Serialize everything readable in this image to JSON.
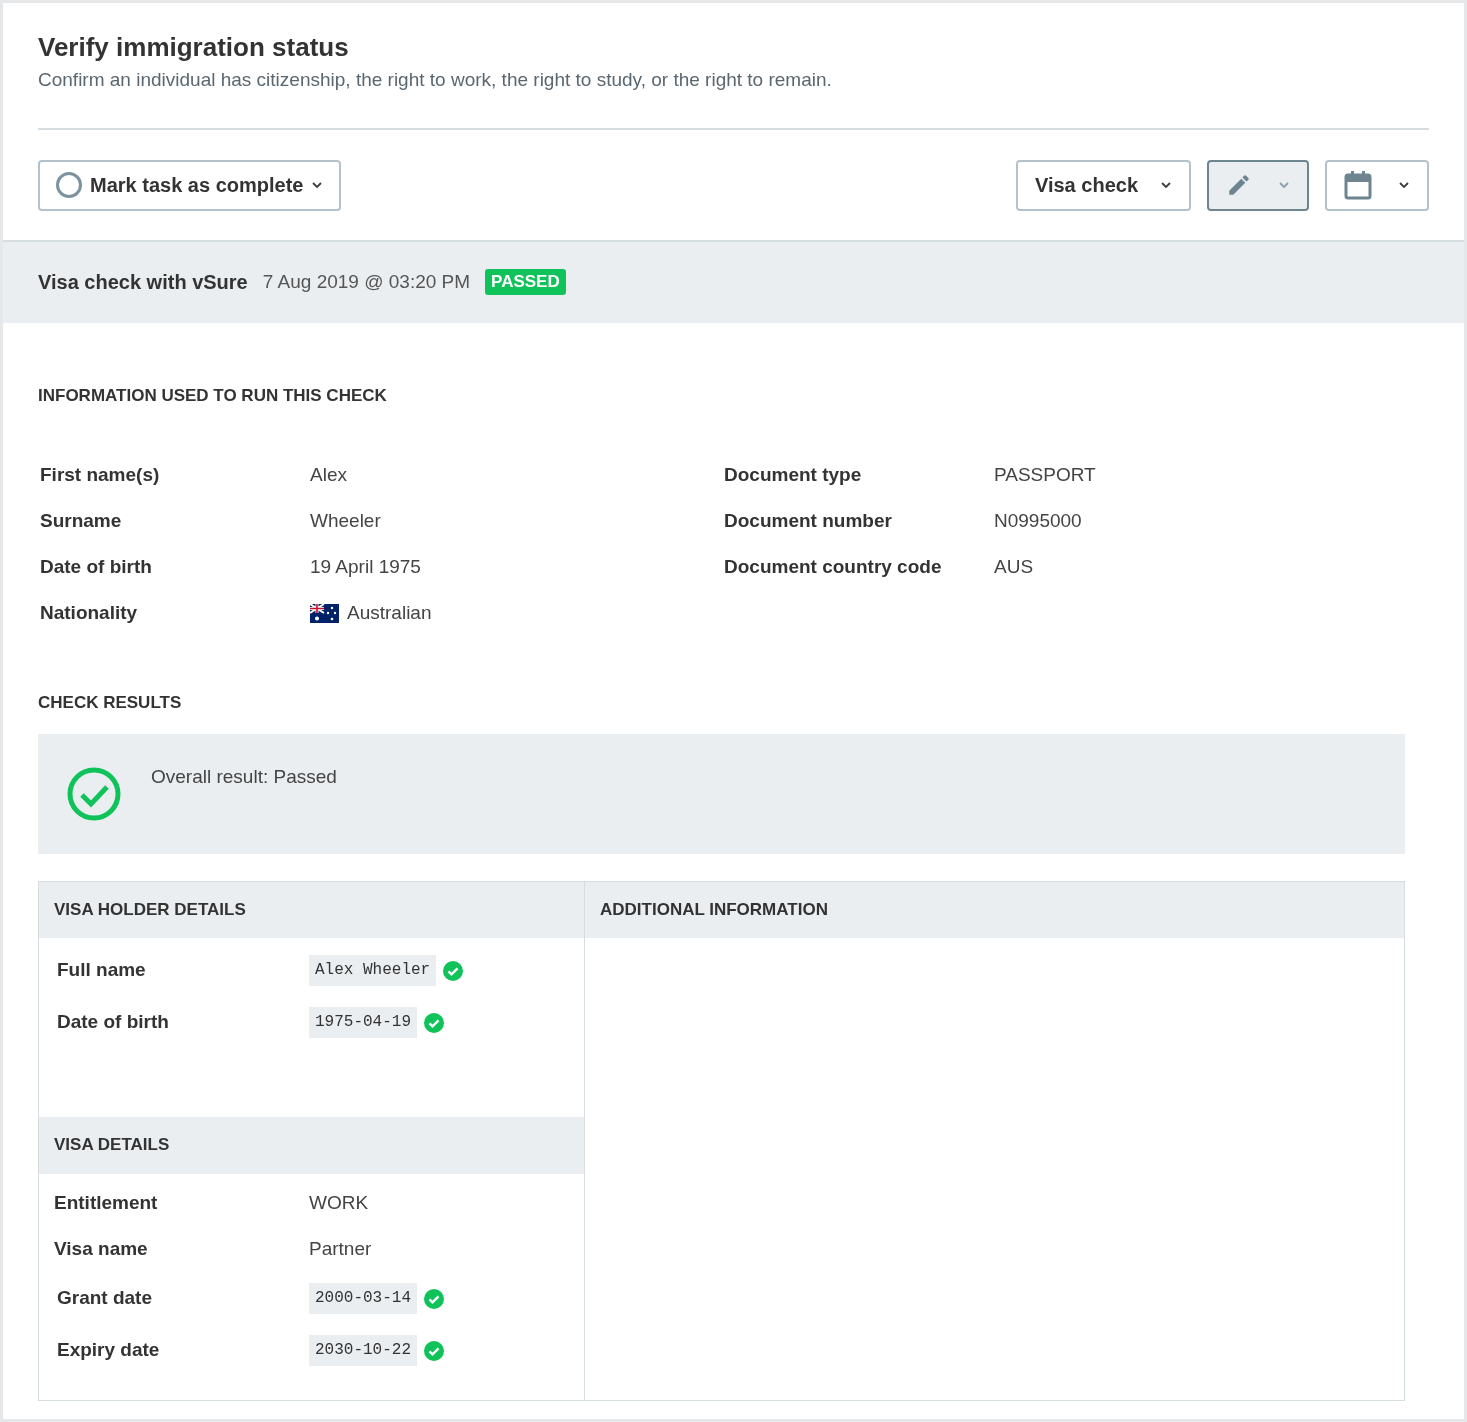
{
  "header": {
    "title": "Verify immigration status",
    "subtitle": "Confirm an individual has citizenship, the right to work, the right to study, or the right to remain."
  },
  "task_button": {
    "label": "Mark task as complete",
    "checked": false
  },
  "toolbar": [
    {
      "kind": "text",
      "label": "Visa check",
      "pressed": false
    },
    {
      "kind": "pencil",
      "pressed": true
    },
    {
      "kind": "calendar",
      "pressed": false
    }
  ],
  "check_bar": {
    "name": "Visa check with vSure",
    "timestamp": "7 Aug 2019 @ 03:20 PM",
    "status": "PASSED"
  },
  "info_section": {
    "heading": "INFORMATION USED TO RUN THIS CHECK",
    "left": [
      {
        "label": "First name(s)",
        "value": "Alex"
      },
      {
        "label": "Surname",
        "value": "Wheeler"
      },
      {
        "label": "Date of birth",
        "value": "19 April 1975"
      },
      {
        "label": "Nationality",
        "value": "Australian",
        "flag": true
      }
    ],
    "right": [
      {
        "label": "Document type",
        "value": "PASSPORT"
      },
      {
        "label": "Document number",
        "value": "N0995000"
      },
      {
        "label": "Document country code",
        "value": "AUS"
      }
    ]
  },
  "results": {
    "heading": "CHECK RESULTS",
    "overall": "Overall result: Passed",
    "passed": true
  },
  "visa_holder": {
    "heading": "VISA HOLDER DETAILS",
    "rows": [
      {
        "kind": "code",
        "label": "Full name",
        "value": "Alex Wheeler",
        "verified": true
      },
      {
        "kind": "code",
        "label": "Date of birth",
        "value": "1975-04-19",
        "verified": true
      }
    ]
  },
  "visa_details": {
    "heading": "VISA DETAILS",
    "rows": [
      {
        "kind": "plain",
        "label": "Entitlement",
        "value": "WORK"
      },
      {
        "kind": "plain",
        "label": "Visa name",
        "value": "Partner"
      },
      {
        "kind": "code",
        "label": "Grant date",
        "value": "2000-03-14",
        "verified": true
      },
      {
        "kind": "code",
        "label": "Expiry date",
        "value": "2030-10-22",
        "verified": true
      }
    ]
  },
  "additional": {
    "heading": "ADDITIONAL INFORMATION"
  }
}
